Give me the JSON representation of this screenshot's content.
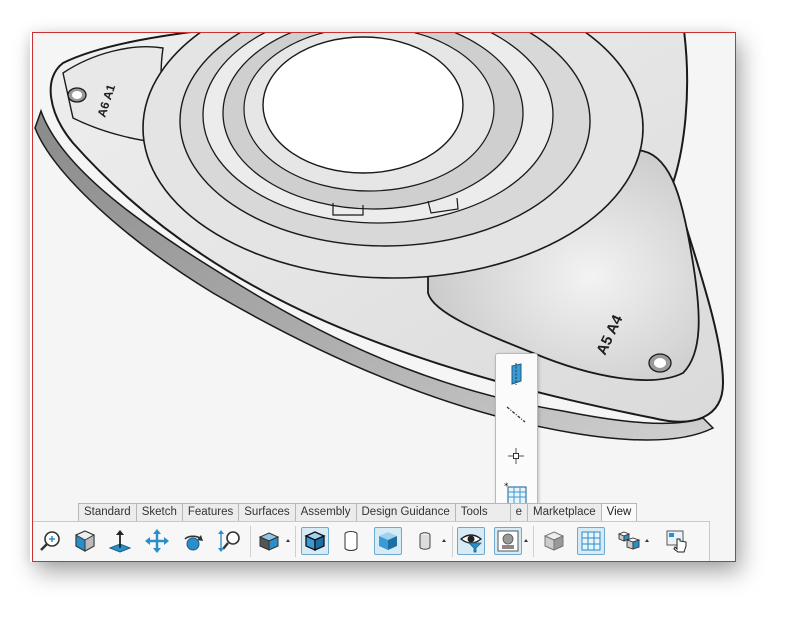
{
  "part": {
    "engraving_left": "A6 A1",
    "engraving_right": "A5 A4"
  },
  "flyout": {
    "items": [
      {
        "icon": "reference-plane-icon"
      },
      {
        "icon": "reference-axis-icon"
      },
      {
        "icon": "reference-point-icon"
      },
      {
        "icon": "coordinate-system-icon"
      }
    ]
  },
  "tabs": [
    {
      "label": "Standard"
    },
    {
      "label": "Sketch"
    },
    {
      "label": "Features"
    },
    {
      "label": "Surfaces"
    },
    {
      "label": "Assembly"
    },
    {
      "label": "Design Guidance"
    },
    {
      "label": "Tools"
    },
    {
      "label": "e"
    },
    {
      "label": "Marketplace"
    },
    {
      "label": "View",
      "active": true
    }
  ],
  "toolbar": {
    "icons": [
      "zoom-to-fit-icon",
      "view-orientation-icon",
      "normal-to-icon",
      "pan-icon",
      "rotate-icon",
      "zoom-icon",
      "display-style-icon",
      "shaded-with-edges-icon",
      "wireframe-icon",
      "shaded-icon",
      "hidden-lines-icon",
      "hide-show-items-icon",
      "appearance-icon",
      "render-tools-icon",
      "grid-icon",
      "components-icon",
      "touch-mode-icon"
    ]
  },
  "colors": {
    "viewport_border": "#c83232",
    "accent_blue": "#2a8ec8",
    "active_tab": "#fafafa"
  }
}
